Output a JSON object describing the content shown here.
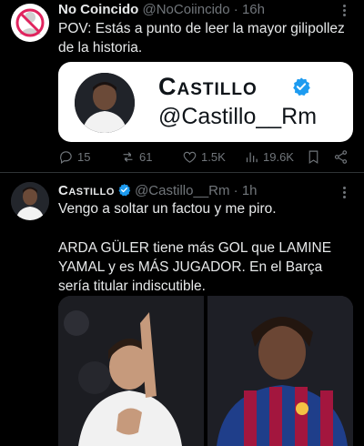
{
  "tweet1": {
    "author_name": "No Coincido",
    "author_handle": "@NoCoiincido",
    "separator": "·",
    "time": "16h",
    "text": "POV: Estás a punto de leer la mayor gilipollez de la historia.",
    "quote_card": {
      "name": "Castillo",
      "handle": "@Castillo__Rm"
    },
    "actions": {
      "replies": "15",
      "retweets": "61",
      "likes": "1.5K",
      "views": "19.6K"
    }
  },
  "tweet2": {
    "author_name": "Castillo",
    "author_handle": "@Castillo__Rm",
    "separator": "·",
    "time": "1h",
    "text_line1": "Vengo a soltar un factou y me piro.",
    "text_paragraph2": "ARDA GÜLER tiene más GOL que LAMINE YAMAL y es MÁS JUGADOR. En el Barça sería titular indiscutible."
  },
  "colors": {
    "background": "#000000",
    "text_primary": "#e7e9ea",
    "text_secondary": "#71767b",
    "verified_blue": "#1d9bf0",
    "card_background": "#ffffff"
  },
  "icons": {
    "more": "more-dots-icon",
    "reply": "reply-icon",
    "retweet": "retweet-icon",
    "like": "heart-icon",
    "views": "views-icon",
    "bookmark": "bookmark-icon",
    "share": "share-icon",
    "verified": "verified-badge-icon"
  }
}
